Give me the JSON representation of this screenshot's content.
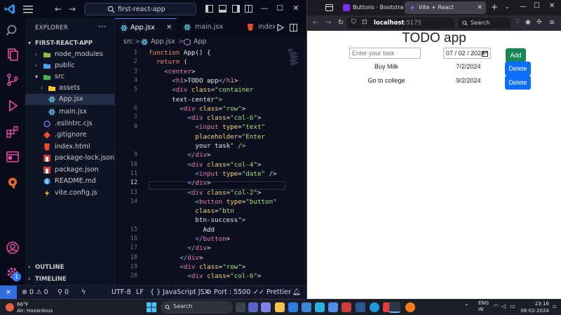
{
  "vscode": {
    "search_text": "first-react-app",
    "explorer_title": "EXPLORER",
    "explorer_more": "···",
    "project": "FIRST-REACT-APP",
    "tree": [
      {
        "label": "node_modules"
      },
      {
        "label": "public"
      },
      {
        "label": "src"
      },
      {
        "label": "assets"
      },
      {
        "label": "App.jsx"
      },
      {
        "label": "main.jsx"
      },
      {
        "label": ".eslintrc.cjs"
      },
      {
        "label": ".gitignore"
      },
      {
        "label": "index.html"
      },
      {
        "label": "package-lock.json"
      },
      {
        "label": "package.json"
      },
      {
        "label": "README.md"
      },
      {
        "label": "vite.config.js"
      }
    ],
    "outline": "OUTLINE",
    "timeline": "TIMELINE",
    "tabs": [
      {
        "label": "App.jsx"
      },
      {
        "label": "main.jsx"
      },
      {
        "label": "index"
      }
    ],
    "breadcrumb": [
      "src",
      ">",
      "App.jsx",
      ">",
      "App"
    ],
    "code_lines": [
      {
        "n": "1",
        "t": "function App() {"
      },
      {
        "n": "2",
        "t": "  return ("
      },
      {
        "n": "3",
        "t": "    <center>"
      },
      {
        "n": "4",
        "t": "      <h1>TODO app</h1>"
      },
      {
        "n": "5",
        "t": "      <div class=\"container"
      },
      {
        "n": "",
        "t": "      text-center\">"
      },
      {
        "n": "6",
        "t": "        <div class=\"row\">"
      },
      {
        "n": "7",
        "t": "          <div class=\"col-6\">"
      },
      {
        "n": "8",
        "t": "            <input type=\"text\""
      },
      {
        "n": "",
        "t": "            placeholder=\"Enter"
      },
      {
        "n": "",
        "t": "            your task\" />"
      },
      {
        "n": "9",
        "t": "          </div>"
      },
      {
        "n": "10",
        "t": "          <div class=\"col-4\">"
      },
      {
        "n": "11",
        "t": "            <input type=\"date\" />"
      },
      {
        "n": "12",
        "t": "          </div>"
      },
      {
        "n": "13",
        "t": "          <div class=\"col-2\">"
      },
      {
        "n": "14",
        "t": "            <button type=\"button\""
      },
      {
        "n": "",
        "t": "            class=\"btn"
      },
      {
        "n": "",
        "t": "            btn-success\">"
      },
      {
        "n": "15",
        "t": "              Add"
      },
      {
        "n": "16",
        "t": "            </button>"
      },
      {
        "n": "17",
        "t": "          </div>"
      },
      {
        "n": "18",
        "t": "        </div>"
      },
      {
        "n": "19",
        "t": "        <div class=\"row\">"
      },
      {
        "n": "20",
        "t": "          <div class=\"col-6\">"
      }
    ],
    "status": {
      "errors": "0",
      "warnings": "0",
      "ports": "0",
      "encoding": "UTF-8",
      "eol": "LF",
      "language": "JavaScript JSX",
      "port": "Port : 5500",
      "prettier": "Prettier"
    },
    "badge": "1"
  },
  "browser": {
    "tabs": [
      {
        "label": "Buttons · Bootstrap v5."
      },
      {
        "label": "Vite + React"
      }
    ],
    "url_host": "localhost",
    "url_port": ":5175",
    "search_placeholder": "Search",
    "page": {
      "title": "TODO app",
      "task_placeholder": "Enter your task",
      "date_value": "07 / 02 / 2024",
      "add_label": "Add",
      "todos": [
        {
          "name": "Buy Milk",
          "date": "7/2/2024",
          "action": "Delete"
        },
        {
          "name": "Go to college",
          "date": "9/2/2024",
          "action": "Delete"
        }
      ]
    }
  },
  "taskbar": {
    "temp": "66°F",
    "weather": "Air: Hazardous",
    "search": "Search",
    "lang1": "ENG",
    "lang2": "IN",
    "time": "23:16",
    "date": "08-02-2024"
  }
}
